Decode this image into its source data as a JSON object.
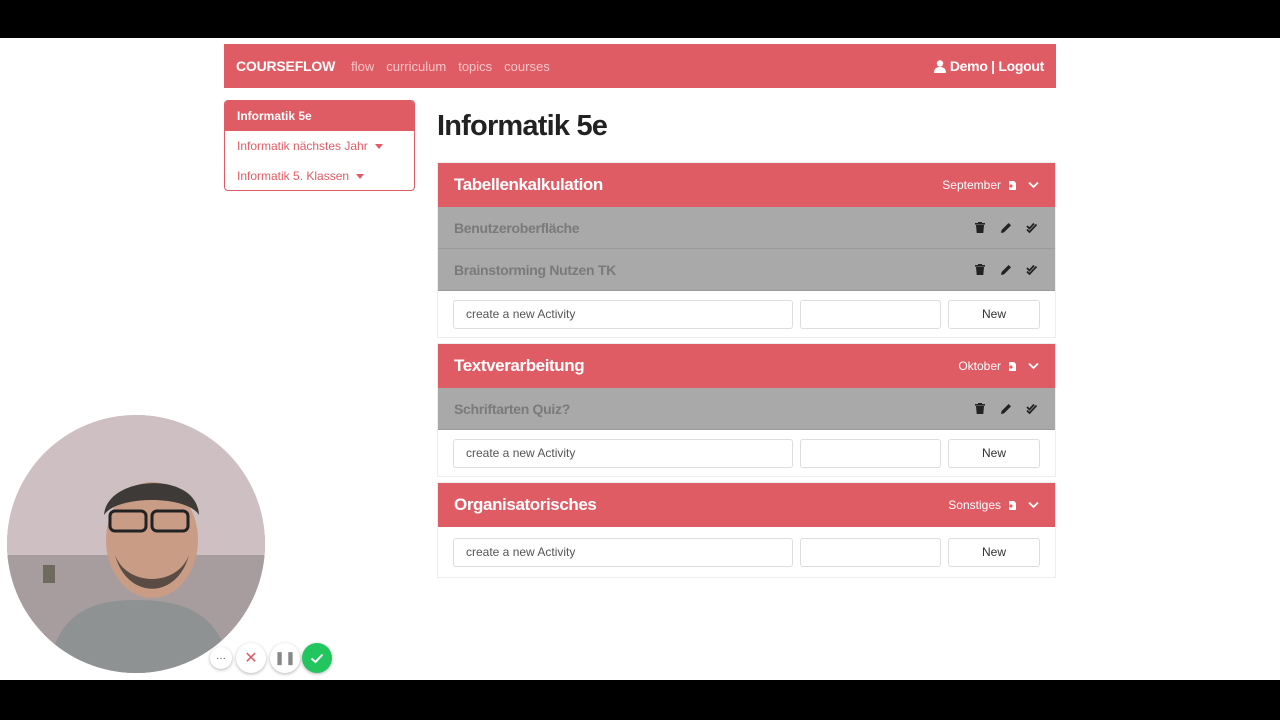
{
  "navbar": {
    "brand": "COURSEFLOW",
    "links": [
      "flow",
      "curriculum",
      "topics",
      "courses"
    ],
    "user_label": "Demo | Logout"
  },
  "sidebar": {
    "items": [
      {
        "label": "Informatik 5e",
        "active": true
      },
      {
        "label": "Informatik nächstes Jahr",
        "active": false
      },
      {
        "label": "Informatik 5. Klassen",
        "active": false
      }
    ]
  },
  "page_title": "Informatik 5e",
  "topics": [
    {
      "title": "Tabellenkalkulation",
      "month": "September",
      "activities": [
        "Benutzeroberfläche",
        "Brainstorming Nutzen TK"
      ],
      "new_placeholder": "create a new Activity",
      "new_button": "New"
    },
    {
      "title": "Textverarbeitung",
      "month": "Oktober",
      "activities": [
        "Schriftarten Quiz?"
      ],
      "new_placeholder": "create a new Activity",
      "new_button": "New"
    },
    {
      "title": "Organisatorisches",
      "month": "Sonstiges",
      "activities": [],
      "new_placeholder": "create a new Activity",
      "new_button": "New"
    }
  ],
  "recording_controls": {
    "more": "···",
    "cancel": "✕",
    "pause": "❚❚"
  },
  "colors": {
    "accent": "#e05c65",
    "activity_bg": "#a9a9a9",
    "confirm": "#22c55e"
  }
}
